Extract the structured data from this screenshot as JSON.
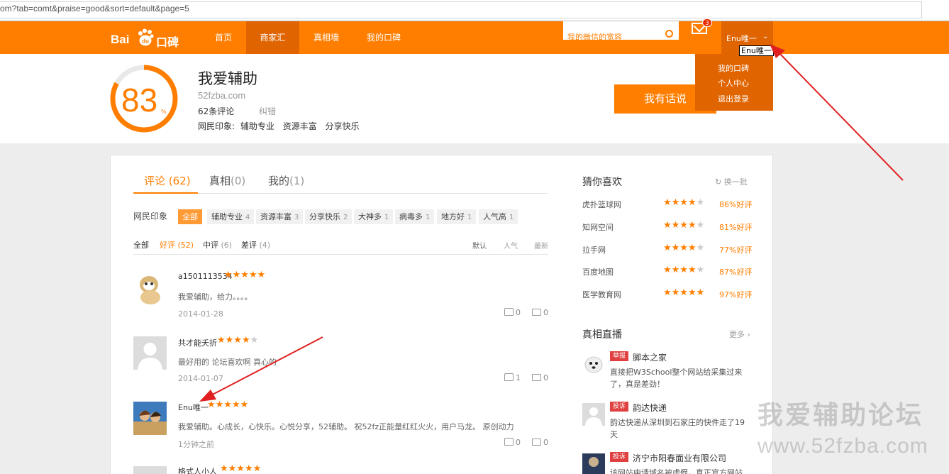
{
  "browser": {
    "url": "om?tab=comt&praise=good&sort=default&page=5"
  },
  "topnav": {
    "logo": {
      "left": "Bai",
      "paw": "du",
      "right": "口碑"
    },
    "items": [
      "首页",
      "商家汇",
      "真相墙",
      "我的口碑"
    ],
    "active_index": 1,
    "search_placeholder": "我的微信的宽容",
    "mail_badge": "3",
    "username": "Enu唯一",
    "tooltip": "Enu唯一",
    "dropdown": [
      "我的口碑",
      "个人中心",
      "退出登录"
    ]
  },
  "business": {
    "score": "83",
    "score_unit": "%",
    "name": "我爱辅助",
    "url": "52fzba.com",
    "comment_count": "62条评论",
    "correction": "纠错",
    "impression_label": "网民印象:",
    "impressions": [
      "辅助专业",
      "资源丰富",
      "分享快乐"
    ],
    "say_button": "我有话说"
  },
  "tabs": [
    {
      "label": "评论",
      "count": "(62)"
    },
    {
      "label": "真相",
      "count": "(0)"
    },
    {
      "label": "我的",
      "count": "(1)"
    }
  ],
  "tags": {
    "label": "网民印象",
    "items": [
      {
        "name": "全部",
        "count": ""
      },
      {
        "name": "辅助专业",
        "count": "4"
      },
      {
        "name": "资源丰富",
        "count": "3"
      },
      {
        "name": "分享快乐",
        "count": "2"
      },
      {
        "name": "大神多",
        "count": "1"
      },
      {
        "name": "病毒多",
        "count": "1"
      },
      {
        "name": "地方好",
        "count": "1"
      },
      {
        "name": "人气高",
        "count": "1"
      }
    ]
  },
  "filters": {
    "items": [
      {
        "label": "全部",
        "count": ""
      },
      {
        "label": "好评",
        "count": "(52)"
      },
      {
        "label": "中评",
        "count": "(6)"
      },
      {
        "label": "差评",
        "count": "(4)"
      }
    ],
    "sort": [
      "默认",
      "人气",
      "最新"
    ]
  },
  "comments": [
    {
      "user": "a1501113534",
      "rating": 5,
      "text": "我爱辅助，给力。。。。",
      "date": "2014-01-28",
      "likes": "0",
      "replies": "0"
    },
    {
      "user": "共才能夭折",
      "rating": 4,
      "text": "最好用的 论坛喜欢啊 真心的",
      "date": "2014-01-07",
      "likes": "1",
      "replies": "0"
    },
    {
      "user": "Enu唯一",
      "rating": 5,
      "text": "我爱辅助。心成长，心快乐。心悦分享，52辅助。 祝52fz正能量红红火火，用户马龙。 原创动力",
      "date": "1分钟之前",
      "likes": "0",
      "replies": "0"
    },
    {
      "user": "格式人小人",
      "rating": 5,
      "text": "",
      "date": "",
      "likes": "",
      "replies": ""
    }
  ],
  "sidebar": {
    "guess_title": "猜你喜欢",
    "refresh": "换一批",
    "recommend": [
      {
        "name": "虎扑篮球网",
        "rating": 4,
        "pct": "86%好评"
      },
      {
        "name": "知网空间",
        "rating": 4,
        "pct": "81%好评"
      },
      {
        "name": "拉手网",
        "rating": 4,
        "pct": "77%好评"
      },
      {
        "name": "百度地图",
        "rating": 4.5,
        "pct": "87%好评"
      },
      {
        "name": "医学教育网",
        "rating": 5,
        "pct": "97%好评"
      }
    ],
    "live_title": "真相直播",
    "more": "更多",
    "live": [
      {
        "badge": "举报",
        "title": "脚本之家",
        "text": "直接把W3School整个网站给采集过来了，真是差劲！"
      },
      {
        "badge": "投诉",
        "title": "韵达快递",
        "text": "韵达快递从深圳到石家庄的快件走了19天"
      },
      {
        "badge": "投诉",
        "title": "济宁市阳春面业有限公司",
        "text": "该网站申请域名被虚假，真正官方网站"
      }
    ]
  },
  "watermark": {
    "line1": "我爱辅助论坛",
    "line2": "www.52fzba.com"
  },
  "colors": {
    "brand": "#ff7e00",
    "brand_dark": "#e06400",
    "badge_red": "#e04040"
  }
}
